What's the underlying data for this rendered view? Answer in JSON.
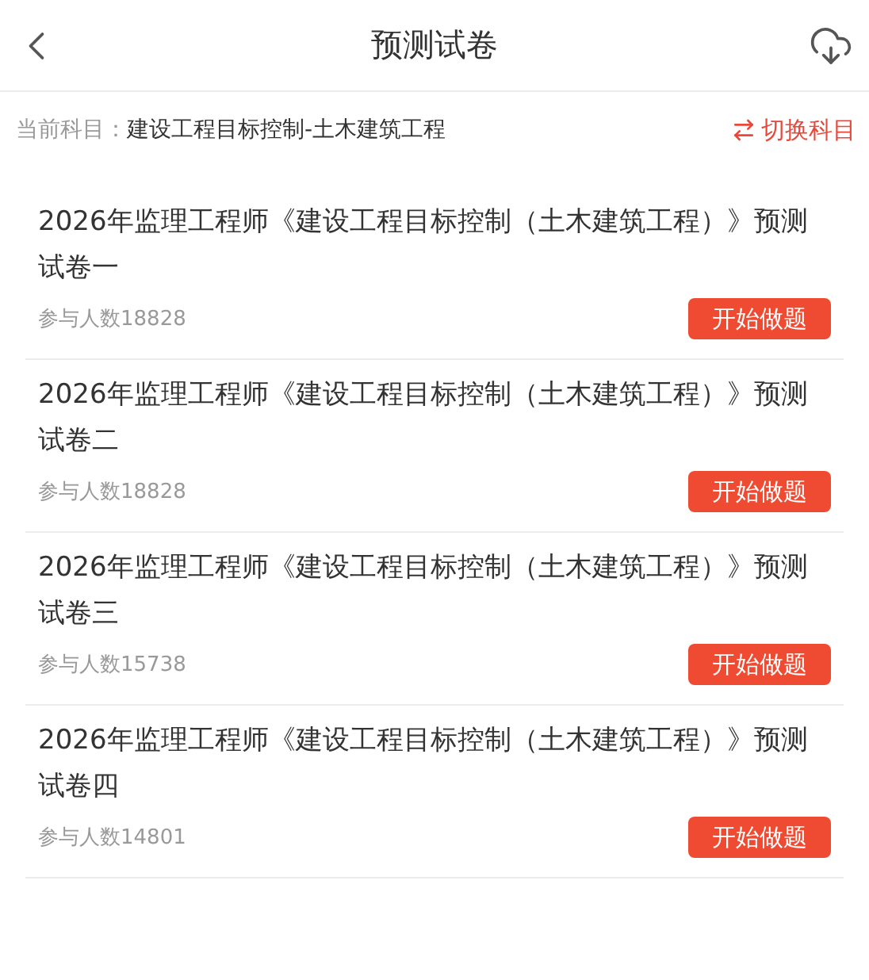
{
  "header": {
    "title": "预测试卷"
  },
  "subject": {
    "label": "当前科目：",
    "value": "建设工程目标控制-土木建筑工程",
    "switch": "切换科目"
  },
  "papers": [
    {
      "title": "2026年监理工程师《建设工程目标控制（土木建筑工程）》预测试卷一",
      "count": "参与人数18828",
      "action": "开始做题"
    },
    {
      "title": "2026年监理工程师《建设工程目标控制（土木建筑工程）》预测试卷二",
      "count": "参与人数18828",
      "action": "开始做题"
    },
    {
      "title": "2026年监理工程师《建设工程目标控制（土木建筑工程）》预测试卷三",
      "count": "参与人数15738",
      "action": "开始做题"
    },
    {
      "title": "2026年监理工程师《建设工程目标控制（土木建筑工程）》预测试卷四",
      "count": "参与人数14801",
      "action": "开始做题"
    }
  ]
}
